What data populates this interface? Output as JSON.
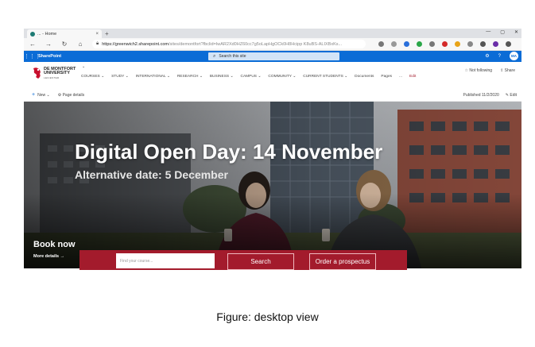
{
  "browser": {
    "tab_title": "... - Home",
    "tab_close": "×",
    "new_tab": "+",
    "window_controls": [
      "—",
      "▢",
      "✕"
    ],
    "nav_buttons": [
      "←",
      "→",
      "↻",
      "⌂"
    ],
    "url_host": "https://greenwich2.sharepoint.com",
    "url_path": "/sites/demontfort?fbclid=IwAR2Xd0HZ60cc7g5oLapHgOCk0H8Hcipp K8uBS-ALIXBxKs...",
    "extension_icons": [
      {
        "name": "sync-icon",
        "color": "#777777"
      },
      {
        "name": "zoom-icon",
        "color": "#999999"
      },
      {
        "name": "favorite-icon",
        "color": "#2a6fdb"
      },
      {
        "name": "shield-icon",
        "color": "#2aa648"
      },
      {
        "name": "camera-icon",
        "color": "#777777"
      },
      {
        "name": "adblock-icon",
        "color": "#d42a2a"
      },
      {
        "name": "folder-icon",
        "color": "#e8a317"
      },
      {
        "name": "puzzle-icon",
        "color": "#888888"
      },
      {
        "name": "collections-icon",
        "color": "#555555"
      },
      {
        "name": "profile-icon",
        "color": "#6a2da8"
      },
      {
        "name": "more-icon",
        "color": "#555555"
      }
    ]
  },
  "suitebar": {
    "waffle": "⋮⋮⋮",
    "app_name": "SharePoint",
    "search_placeholder": "Search this site",
    "settings_icon": "⚙",
    "help_icon": "?",
    "avatar_initials": "MA"
  },
  "site": {
    "logo_lines": [
      "DE MONTFORT",
      "UNIVERSITY"
    ],
    "logo_sub": "LEICESTER",
    "nav": [
      {
        "label": "COURSES",
        "dropdown": true
      },
      {
        "label": "STUDY",
        "dropdown": true
      },
      {
        "label": "INTERNATIONAL",
        "dropdown": true
      },
      {
        "label": "RESEARCH",
        "dropdown": true
      },
      {
        "label": "BUSINESS",
        "dropdown": true
      },
      {
        "label": "CAMPUS",
        "dropdown": true
      },
      {
        "label": "COMMUNITY",
        "dropdown": true
      },
      {
        "label": "CURRENT STUDENTS",
        "dropdown": true
      },
      {
        "label": "Documents",
        "dropdown": false
      },
      {
        "label": "Pages",
        "dropdown": false
      },
      {
        "label": "...",
        "dropdown": false
      },
      {
        "label": "Edit",
        "dropdown": false
      }
    ],
    "not_following": "Not following",
    "share": "Share"
  },
  "commandbar": {
    "new_label": "New",
    "page_details": "Page details",
    "published": "Published 11/2/2020",
    "edit": "Edit"
  },
  "hero": {
    "title": "Digital Open Day: 14 November",
    "subtitle": "Alternative date: 5 December",
    "book_now": "Book now",
    "more_details": "More details →"
  },
  "course_search": {
    "placeholder": "Find your course...",
    "search_button": "Search",
    "prospectus_button": "Order a prospectus"
  },
  "caption": "Figure: desktop view",
  "colors": {
    "suitebar": "#0b6cd6",
    "brand_red": "#a31b2c"
  }
}
